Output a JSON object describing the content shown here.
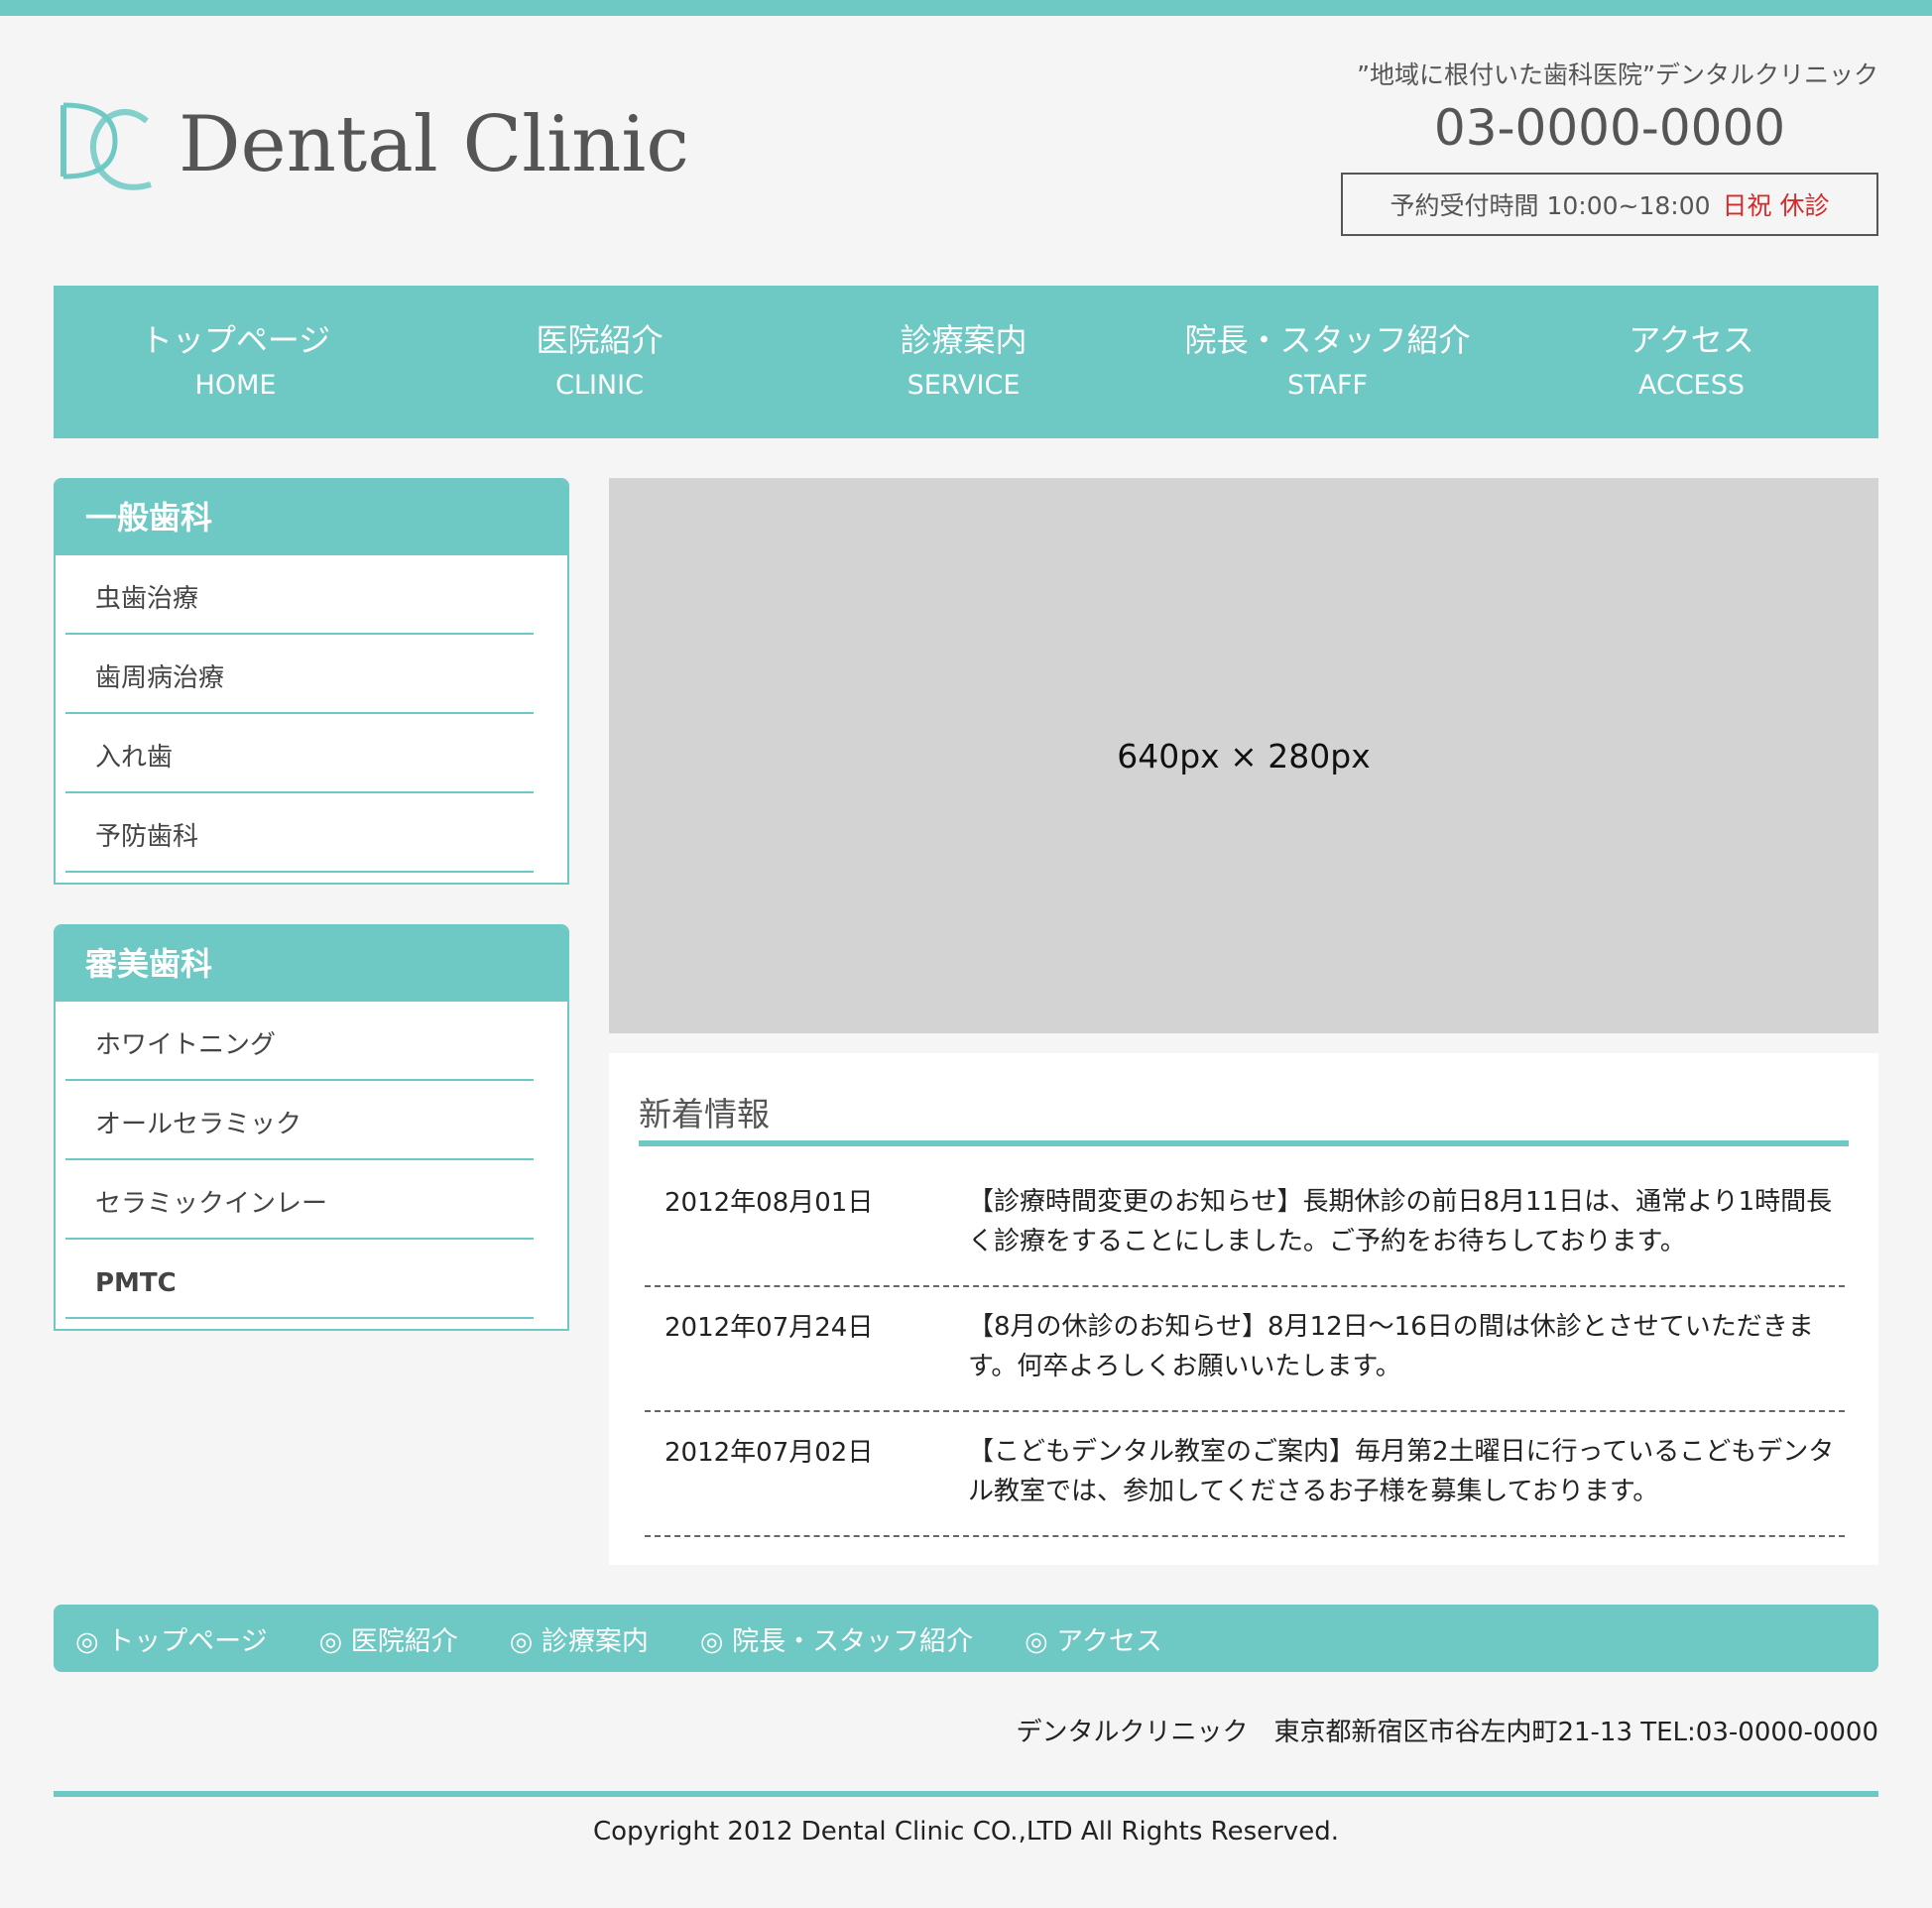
{
  "header": {
    "logo_text": "Dental Clinic",
    "tagline": "”地域に根付いた歯科医院”デンタルクリニック",
    "phone": "03-0000-0000",
    "hours_label": "予約受付時間 10:00~18:00",
    "hours_closed": "日祝 休診"
  },
  "colors": {
    "accent": "#6ec8c4",
    "closed": "#d62a2a",
    "placeholder": "#d3d3d3"
  },
  "nav": [
    {
      "jp": "トップページ",
      "en": "HOME"
    },
    {
      "jp": "医院紹介",
      "en": "CLINIC"
    },
    {
      "jp": "診療案内",
      "en": "SERVICE"
    },
    {
      "jp": "院長・スタッフ紹介",
      "en": "STAFF"
    },
    {
      "jp": "アクセス",
      "en": "ACCESS"
    }
  ],
  "sidebar": {
    "general": {
      "title": "一般歯科",
      "items": [
        "虫歯治療",
        "歯周病治療",
        "入れ歯",
        "予防歯科"
      ]
    },
    "cosmetic": {
      "title": "審美歯科",
      "items": [
        "ホワイトニング",
        "オールセラミック",
        "セラミックインレー",
        "PMTC"
      ]
    }
  },
  "hero": {
    "placeholder_text": "640px × 280px"
  },
  "news": {
    "title": "新着情報",
    "items": [
      {
        "date": "2012年08月01日",
        "text": "【診療時間変更のお知らせ】長期休診の前日8月11日は、通常より1時間長く診療をすることにしました。ご予約をお待ちしております。"
      },
      {
        "date": "2012年07月24日",
        "text": "【8月の休診のお知らせ】8月12日〜16日の間は休診とさせていただきます。何卒よろしくお願いいたします。"
      },
      {
        "date": "2012年07月02日",
        "text": "【こどもデンタル教室のご案内】毎月第2土曜日に行っているこどもデンタル教室では、参加してくださるお子様を募集しております。"
      }
    ]
  },
  "footer": {
    "nav": [
      "◎ トップページ",
      "◎ 医院紹介",
      "◎ 診療案内",
      "◎ 院長・スタッフ紹介",
      "◎ アクセス"
    ],
    "address": "デンタルクリニック　東京都新宿区市谷左内町21-13 TEL:03-0000-0000",
    "copyright": "Copyright 2012 Dental Clinic CO.,LTD All Rights Reserved."
  }
}
